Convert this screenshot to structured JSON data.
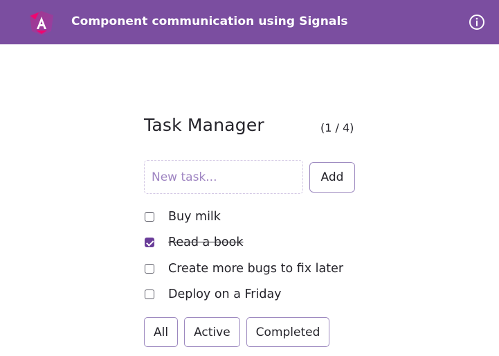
{
  "header": {
    "title": "Component communication using Signals",
    "logo_icon": "angular-logo-icon",
    "info_icon": "info-circle-icon",
    "background_color": "#7b4ea0"
  },
  "task_manager": {
    "heading": "Task Manager",
    "counter": "(1 / 4)",
    "new_task_placeholder": "New task...",
    "new_task_value": "",
    "add_label": "Add",
    "tasks": [
      {
        "label": "Buy milk",
        "completed": false
      },
      {
        "label": "Read a book",
        "completed": true
      },
      {
        "label": "Create more bugs to fix later",
        "completed": false
      },
      {
        "label": "Deploy on a Friday",
        "completed": false
      }
    ],
    "filters": [
      {
        "label": "All"
      },
      {
        "label": "Active"
      },
      {
        "label": "Completed"
      }
    ],
    "accent_color": "#6a3d99"
  }
}
